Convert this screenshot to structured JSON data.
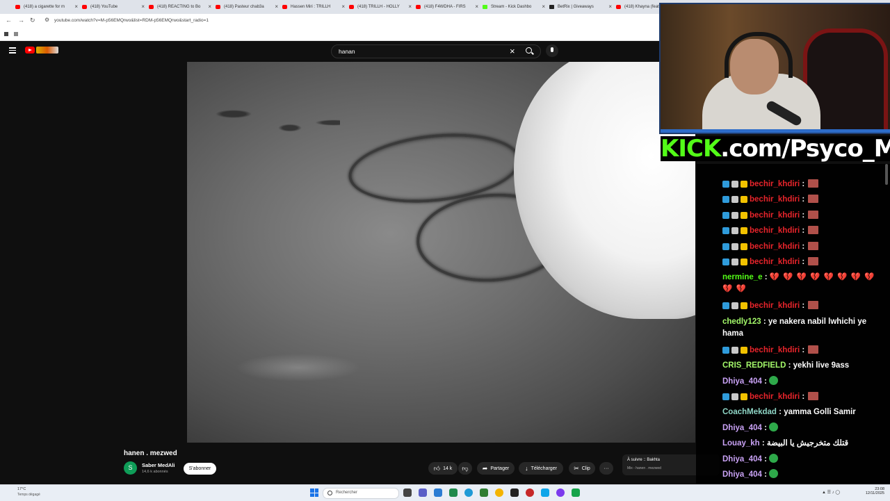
{
  "browser": {
    "tabs": [
      {
        "label": "(418) a cigarette for m",
        "kind": "youtube"
      },
      {
        "label": "(418) YouTube",
        "kind": "youtube"
      },
      {
        "label": "(418) REACTING to Bo",
        "kind": "youtube"
      },
      {
        "label": "(418) Pasteur chab3a",
        "kind": "youtube"
      },
      {
        "label": "Hassen Miri : TRILLH",
        "kind": "youtube"
      },
      {
        "label": "(418) TRILLH - HOLLY",
        "kind": "youtube"
      },
      {
        "label": "(418) F4WDHA - FIRS",
        "kind": "youtube"
      },
      {
        "label": "Stream - Kick Dashbo",
        "kind": "kick"
      },
      {
        "label": "BetRix | Giveaways",
        "kind": "betrix"
      },
      {
        "label": "(418) Khayna (feat",
        "kind": "youtube"
      }
    ],
    "url": "youtube.com/watch?v=M-p56EMQrwo&list=RDM-p56EMQrwo&start_radio=1"
  },
  "youtube": {
    "search_query": "hanan",
    "video_title": "hanen . mezwed",
    "channel_name": "Saber MedAli",
    "channel_initial": "S",
    "subscribers": "14,6 k abonnés",
    "subscribe_label": "S'abonner",
    "likes": "14 k",
    "share_label": "Partager",
    "download_label": "Télécharger",
    "clip_label": "Clip",
    "more_label": "···",
    "up_next_label": "À suivre :: Bakhta",
    "up_next_sub": "Mix - hanen . mezwed"
  },
  "overlay": {
    "kick_brand": "KICK",
    "kick_rest": ".com/Psyco_M"
  },
  "chat": {
    "messages": [
      {
        "user": "bechir_khdiri",
        "text": "",
        "color": "red",
        "badges": true,
        "emote": "red"
      },
      {
        "user": "bechir_khdiri",
        "text": "",
        "color": "red",
        "badges": true,
        "emote": "red"
      },
      {
        "user": "bechir_khdiri",
        "text": "",
        "color": "red",
        "badges": true,
        "emote": "red"
      },
      {
        "user": "bechir_khdiri",
        "text": "",
        "color": "red",
        "badges": true,
        "emote": "red"
      },
      {
        "user": "bechir_khdiri",
        "text": "",
        "color": "red",
        "badges": true,
        "emote": "red"
      },
      {
        "user": "bechir_khdiri",
        "text": "",
        "color": "red",
        "badges": true,
        "emote": "red"
      },
      {
        "user": "nermine_e",
        "text": "💔 💔 💔 💔 💔 💔 💔 💔 💔 💔",
        "color": "green",
        "badges": false,
        "emote": ""
      },
      {
        "user": "bechir_khdiri",
        "text": "",
        "color": "red",
        "badges": true,
        "emote": "red"
      },
      {
        "user": "chedly123",
        "text": "ye nakera nabil lwhichi ye hama",
        "color": "lime",
        "badges": false,
        "emote": ""
      },
      {
        "user": "bechir_khdiri",
        "text": "",
        "color": "red",
        "badges": true,
        "emote": "red"
      },
      {
        "user": "CRIS_REDFIELD",
        "text": "yekhi live 9ass",
        "color": "lime",
        "badges": false,
        "emote": ""
      },
      {
        "user": "Dhiya_404",
        "text": "",
        "color": "purple",
        "badges": false,
        "emote": "green"
      },
      {
        "user": "bechir_khdiri",
        "text": "",
        "color": "red",
        "badges": true,
        "emote": "red"
      },
      {
        "user": "CoachMekdad",
        "text": "yamma Golli Samir",
        "color": "teal",
        "badges": false,
        "emote": ""
      },
      {
        "user": "Dhiya_404",
        "text": "",
        "color": "purple",
        "badges": false,
        "emote": "green"
      },
      {
        "user": "Louay_kh",
        "text": "قتلك متخرجيش يا البيضة",
        "color": "purple",
        "badges": false,
        "emote": ""
      },
      {
        "user": "Dhiya_404",
        "text": "",
        "color": "purple",
        "badges": false,
        "emote": "green"
      },
      {
        "user": "Dhiya_404",
        "text": "",
        "color": "purple",
        "badges": false,
        "emote": "green"
      }
    ]
  },
  "taskbar": {
    "temperature": "17°C",
    "weather": "Temps dégagé",
    "search_placeholder": "Rechercher",
    "time": "23:08",
    "date": "12/11/2025"
  },
  "colors": {
    "youtube_red": "#ff0000",
    "kick_green": "#53fc18",
    "chat_red": "#e8242b"
  }
}
